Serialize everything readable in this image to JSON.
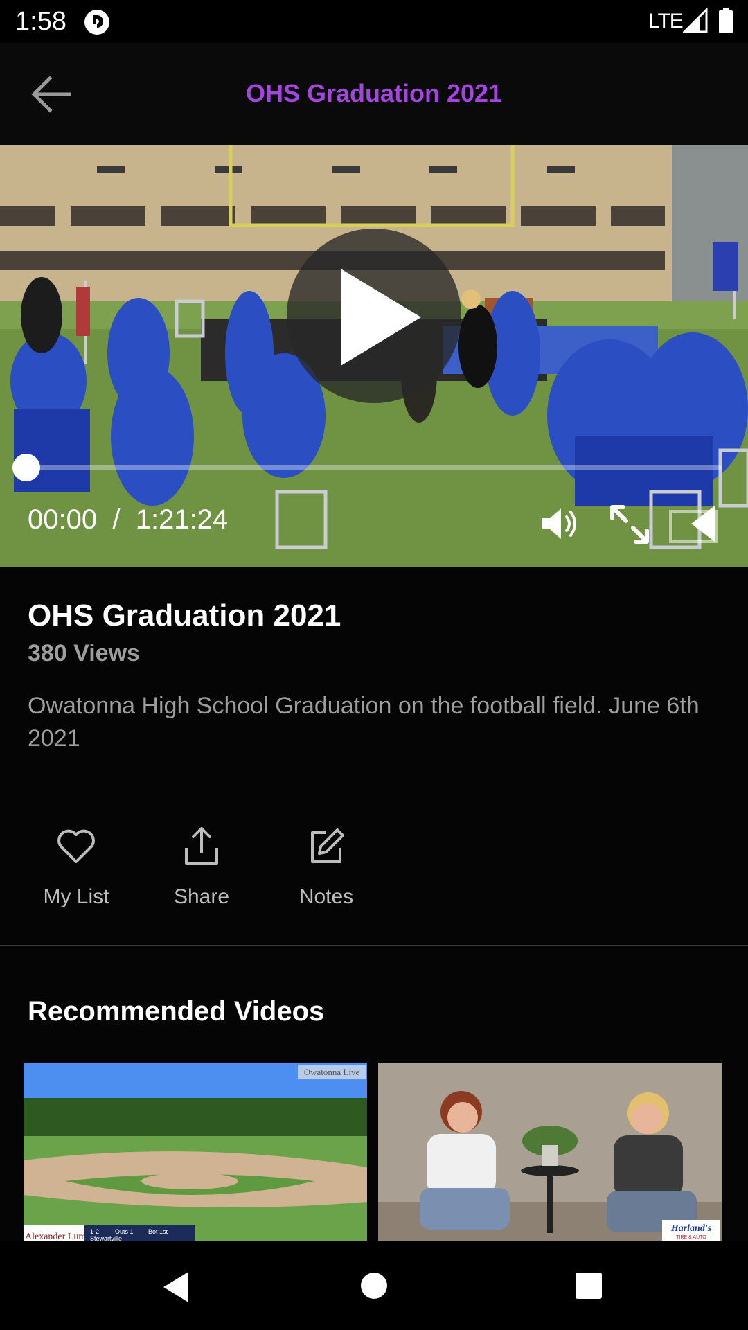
{
  "status_bar": {
    "time": "1:58",
    "network": "LTE"
  },
  "app_bar": {
    "title": "OHS Graduation 2021",
    "back_icon": "arrow-left-icon"
  },
  "player": {
    "current_time": "00:00",
    "separator": "/",
    "duration": "1:21:24",
    "progress": 0,
    "icons": [
      "play-icon",
      "volume-icon",
      "fullscreen-icon",
      "cast-icon"
    ]
  },
  "video": {
    "title": "OHS Graduation 2021",
    "views": "380 Views",
    "description": "Owatonna High School Graduation on the football field. June 6th 2021"
  },
  "actions": [
    {
      "label": "My List",
      "icon": "heart-icon"
    },
    {
      "label": "Share",
      "icon": "share-icon"
    },
    {
      "label": "Notes",
      "icon": "edit-note-icon"
    }
  ],
  "recommended": {
    "heading": "Recommended Videos",
    "items": [
      {
        "watermark": "Owatonna Live",
        "sponsor": "Alexander Lumber",
        "score_labels": [
          "1-2",
          "Outs 1",
          "Bot 1st"
        ],
        "team": "Stewartville"
      },
      {
        "sponsor": "Harland's",
        "sponsor_sub": "TIRE & AUTO"
      }
    ]
  },
  "colors": {
    "accent": "#a445e0",
    "background": "#050505",
    "muted_text": "#9e9e9e"
  }
}
